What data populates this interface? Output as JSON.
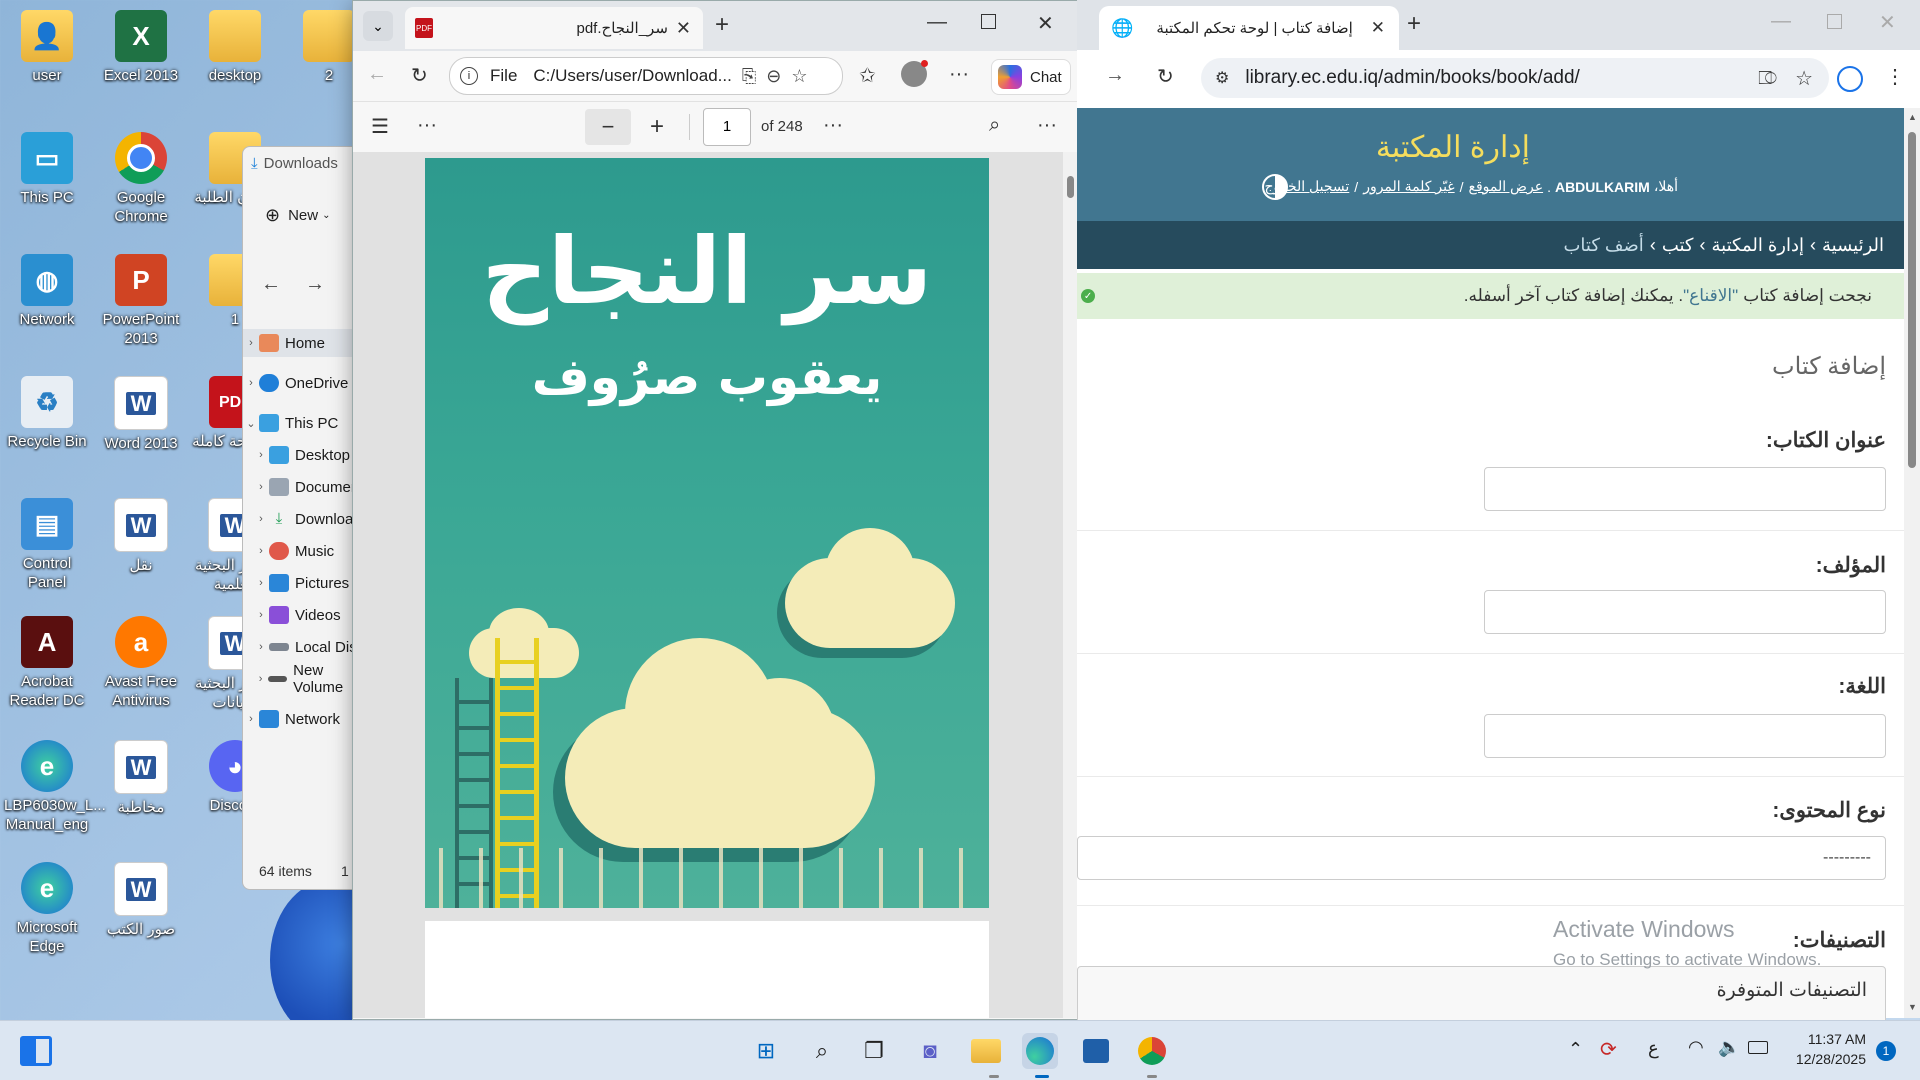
{
  "desktop": {
    "icons_col1": [
      {
        "label": "user",
        "icon": "user-folder-icon"
      },
      {
        "label": "This PC",
        "icon": "monitor-icon"
      },
      {
        "label": "Network",
        "icon": "network-icon"
      },
      {
        "label": "Recycle Bin",
        "icon": "recycle-bin-icon"
      },
      {
        "label": "Control Panel",
        "icon": "control-panel-icon"
      },
      {
        "label": "Acrobat Reader DC",
        "icon": "acrobat-icon"
      },
      {
        "label": "LBP6030w_L... Manual_eng",
        "icon": "edge-icon"
      },
      {
        "label": "Microsoft Edge",
        "icon": "edge-icon"
      }
    ],
    "icons_col2": [
      {
        "label": "Excel 2013",
        "icon": "excel-icon"
      },
      {
        "label": "Google Chrome",
        "icon": "chrome-icon"
      },
      {
        "label": "PowerPoint 2013",
        "icon": "powerpoint-icon"
      },
      {
        "label": "Word 2013",
        "icon": "word-icon"
      },
      {
        "label": "نقل",
        "icon": "word-doc-icon"
      },
      {
        "label": "Avast Free Antivirus",
        "icon": "avast-icon"
      },
      {
        "label": "مخاطبة",
        "icon": "word-doc-icon"
      },
      {
        "label": "صور الكتب",
        "icon": "word-doc-icon"
      }
    ],
    "icons_col3": [
      {
        "label": "desktop",
        "icon": "folder-icon"
      },
      {
        "label": "شؤون الطلبة",
        "icon": "folder-icon"
      },
      {
        "label": "1",
        "icon": "folder-icon"
      },
      {
        "label": "أطروحة كاملة",
        "icon": "pdf-icon"
      },
      {
        "label": "مراكز البحثية العلمية",
        "icon": "word-doc-icon"
      },
      {
        "label": "مراكز البحثية البيانات",
        "icon": "word-doc-icon"
      },
      {
        "label": "Discord",
        "icon": "discord-icon"
      }
    ],
    "icons_col4": [
      {
        "label": "2",
        "icon": "folder-icon"
      }
    ]
  },
  "explorer": {
    "title": "Downloads",
    "new_label": "New",
    "nav": [
      "Home",
      "OneDrive",
      "This PC",
      "Desktop",
      "Documents",
      "Downloads",
      "Music",
      "Pictures",
      "Videos",
      "Local Disk",
      "New Volume",
      "Network"
    ],
    "status": "64 items",
    "status2": "1"
  },
  "pdf_window": {
    "tab_title": "سر_النجاح.pdf",
    "url_prefix": "File",
    "url": "C:/Users/user/Download...",
    "chat_label": "Chat",
    "page_number": "1",
    "page_total": "of 248",
    "cover_title": "سر النجاح",
    "cover_author": "يعقوب صرُوف"
  },
  "chrome_window": {
    "tab_title": "إضافة كتاب | لوحة تحكم المكتبة",
    "url": "library.ec.edu.iq/admin/books/book/add/",
    "header_title": "إدارة المكتبة",
    "welcome": "أهلا،",
    "username": "ABDULKARIM",
    "links": [
      "عرض الموقع",
      "غيّر كلمة المرور",
      "تسجيل الخروج"
    ],
    "breadcrumbs": [
      "الرئيسية",
      "إدارة المكتبة",
      "كتب",
      "أضف كتاب"
    ],
    "success_message_before": "نجحت إضافة كتاب",
    "success_book": "\"الاقناع\"",
    "success_message_after": ". يمكنك إضافة كتاب آخر أسفله.",
    "form_title": "إضافة كتاب",
    "fields": [
      {
        "label": "عنوان الكتاب:",
        "value": ""
      },
      {
        "label": "المؤلف:",
        "value": ""
      },
      {
        "label": "اللغة:",
        "value": ""
      },
      {
        "label": "نوع المحتوى:",
        "value": "---------"
      },
      {
        "label": "التصنيفات:",
        "value": "التصنيفات المتوفرة"
      }
    ],
    "watermark_title": "Activate Windows",
    "watermark_sub": "Go to Settings to activate Windows."
  },
  "taskbar": {
    "time": "11:37 AM",
    "date": "12/28/2025",
    "lang": "ع",
    "notification_count": "1"
  }
}
